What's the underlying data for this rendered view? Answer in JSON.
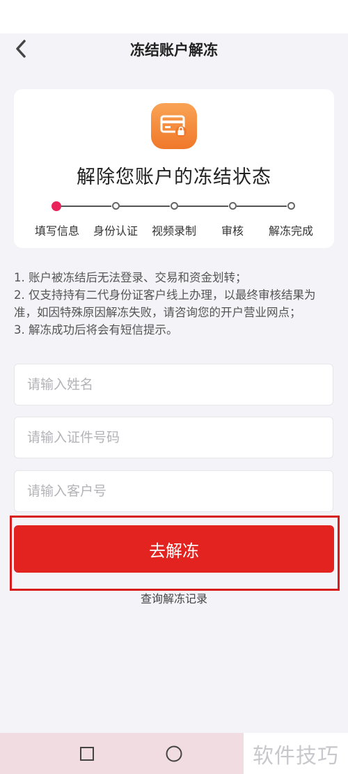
{
  "header": {
    "title": "冻结账户解冻",
    "back_icon": "chevron-left-icon"
  },
  "card": {
    "icon": "card-lock-icon",
    "title": "解除您账户的冻结状态",
    "steps": [
      {
        "label": "填写信息",
        "active": true
      },
      {
        "label": "身份认证",
        "active": false
      },
      {
        "label": "视频录制",
        "active": false
      },
      {
        "label": "审核",
        "active": false
      },
      {
        "label": "解冻完成",
        "active": false
      }
    ]
  },
  "notes": [
    "1. 账户被冻结后无法登录、交易和资金划转；",
    "2. 仅支持持有二代身份证客户线上办理，以最终审核结果为准，如因特殊原因解冻失败，请咨询您的开户营业网点；",
    "3. 解冻成功后将会有短信提示。"
  ],
  "form": {
    "name_placeholder": "请输入姓名",
    "id_placeholder": "请输入证件号码",
    "customer_placeholder": "请输入客户号",
    "submit_label": "去解冻",
    "records_link": "查询解冻记录"
  },
  "watermark": "软件技巧",
  "colors": {
    "primary": "#e3231f",
    "active_step": "#e8245a",
    "icon_gradient_top": "#f9a355",
    "icon_gradient_bottom": "#f0782a"
  }
}
